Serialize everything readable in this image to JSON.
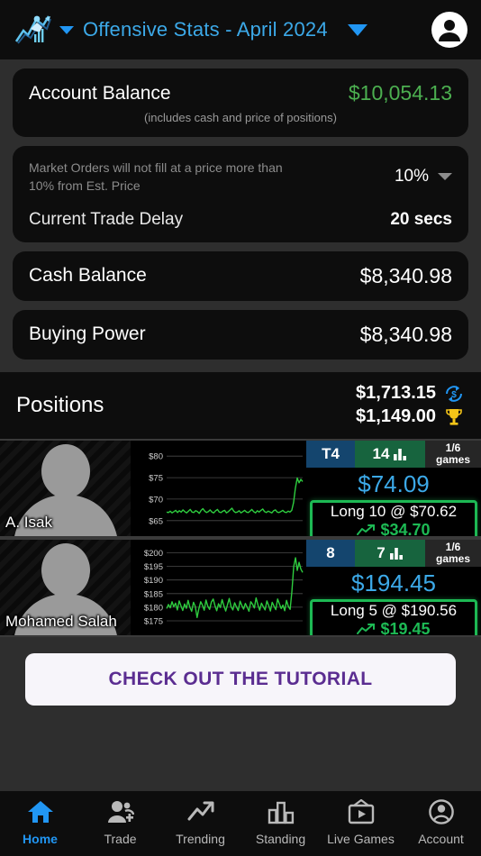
{
  "header": {
    "logo_icon": "running-athlete-chart-logo",
    "league_caret_icon": "caret-down-icon",
    "title": "Offensive Stats - April 2024",
    "title_caret_icon": "caret-down-icon",
    "account_icon": "account-circle-icon"
  },
  "account_balance": {
    "label": "Account Balance",
    "value": "$10,054.13",
    "note": "(includes cash and price of positions)",
    "value_color": "#4caf50"
  },
  "market_orders": {
    "warning": "Market Orders will not fill at a price more than 10% from Est. Price",
    "percent": "10%",
    "chevron_icon": "chevron-down-icon",
    "delay_label": "Current Trade Delay",
    "delay_value": "20 secs"
  },
  "cash_balance": {
    "label": "Cash Balance",
    "value": "$8,340.98"
  },
  "buying_power": {
    "label": "Buying Power",
    "value": "$8,340.98"
  },
  "positions": {
    "title": "Positions",
    "total_value": "$1,713.15",
    "total_value_icon": "currency-exchange-icon",
    "total_winnings": "$1,149.00",
    "total_winnings_icon": "trophy-icon",
    "rows": [
      {
        "name": "A. Isak",
        "avatar_icon": "player-silhouette-icon",
        "rank_badge": "T4",
        "score_badge": "14",
        "score_icon": "bar-chart-icon",
        "games_top": "1/6",
        "games_bottom": "games",
        "price": "$74.09",
        "position_text": "Long 10 @ $70.62",
        "pnl": "$34.70",
        "pnl_icon": "trending-up-icon",
        "chart": {
          "type": "line",
          "ylabel": "",
          "yticks": [
            "$80",
            "$75",
            "$70",
            "$65"
          ],
          "ylim": [
            63.5,
            81.5
          ],
          "series": [
            {
              "name": "price",
              "color": "#2ecc3f",
              "values": [
                67.0,
                66.9,
                67.2,
                66.8,
                67.1,
                67.4,
                66.9,
                67.3,
                67.0,
                67.5,
                67.1,
                66.8,
                67.2,
                67.6,
                67.0,
                66.9,
                67.3,
                67.1,
                66.7,
                67.4,
                67.8,
                67.2,
                66.9,
                67.1,
                67.5,
                67.0,
                66.8,
                67.3,
                67.6,
                67.0,
                66.9,
                67.2,
                67.4,
                66.8,
                67.1,
                67.5,
                67.9,
                67.2,
                66.9,
                67.0,
                67.3,
                66.8,
                67.1,
                67.4,
                67.0,
                66.9,
                67.2,
                67.6,
                67.1,
                66.8,
                67.3,
                67.0,
                67.4,
                67.7,
                67.1,
                66.9,
                67.2,
                67.0,
                66.8,
                67.3,
                67.5,
                67.0,
                66.9,
                67.1,
                67.4,
                67.0,
                66.9,
                67.2,
                67.0,
                67.4,
                69.2,
                72.5,
                74.9,
                73.8,
                74.6,
                74.1
              ]
            }
          ]
        }
      },
      {
        "name": "Mohamed Salah",
        "avatar_icon": "player-silhouette-icon",
        "rank_badge": "8",
        "score_badge": "7",
        "score_icon": "bar-chart-icon",
        "games_top": "1/6",
        "games_bottom": "games",
        "price": "$194.45",
        "position_text": "Long 5 @ $190.56",
        "pnl": "$19.45",
        "pnl_icon": "trending-up-icon",
        "chart": {
          "type": "line",
          "ylabel": "",
          "yticks": [
            "$200",
            "$195",
            "$190",
            "$185",
            "$180",
            "$175"
          ],
          "ylim": [
            173,
            201.5
          ],
          "series": [
            {
              "name": "price",
              "color": "#2ecc3f",
              "values": [
                179.5,
                181.0,
                179.8,
                182.0,
                180.2,
                181.5,
                179.0,
                182.3,
                180.5,
                178.8,
                181.2,
                179.6,
                182.5,
                180.0,
                178.5,
                181.8,
                180.3,
                176.2,
                179.5,
                182.0,
                180.8,
                178.9,
                182.6,
                180.4,
                179.2,
                181.9,
                183.0,
                180.6,
                178.7,
                181.3,
                179.9,
                182.8,
                180.5,
                178.6,
                181.0,
                183.2,
                180.2,
                179.0,
                181.6,
                180.1,
                178.8,
                182.2,
                180.7,
                179.3,
                181.4,
                180.0,
                178.5,
                182.0,
                181.1,
                179.7,
                183.4,
                180.9,
                178.9,
                181.5,
                180.2,
                179.0,
                182.3,
                180.6,
                178.6,
                181.8,
                180.4,
                179.1,
                183.0,
                181.2,
                179.5,
                180.8,
                178.7,
                182.5,
                180.3,
                179.2,
                186.0,
                195.0,
                198.2,
                193.5,
                196.5,
                194.0,
                192.8
              ]
            }
          ]
        }
      }
    ]
  },
  "tutorial": {
    "label": "CHECK OUT THE TUTORIAL"
  },
  "bottom_nav": {
    "items": [
      {
        "label": "Home",
        "icon": "home-icon",
        "active": true
      },
      {
        "label": "Trade",
        "icon": "person-add-icon",
        "active": false
      },
      {
        "label": "Trending",
        "icon": "trending-up-icon",
        "active": false
      },
      {
        "label": "Standing",
        "icon": "bar-chart-icon",
        "active": false
      },
      {
        "label": "Live Games",
        "icon": "live-tv-icon",
        "active": false
      },
      {
        "label": "Account",
        "icon": "account-circle-icon",
        "active": false
      }
    ]
  }
}
